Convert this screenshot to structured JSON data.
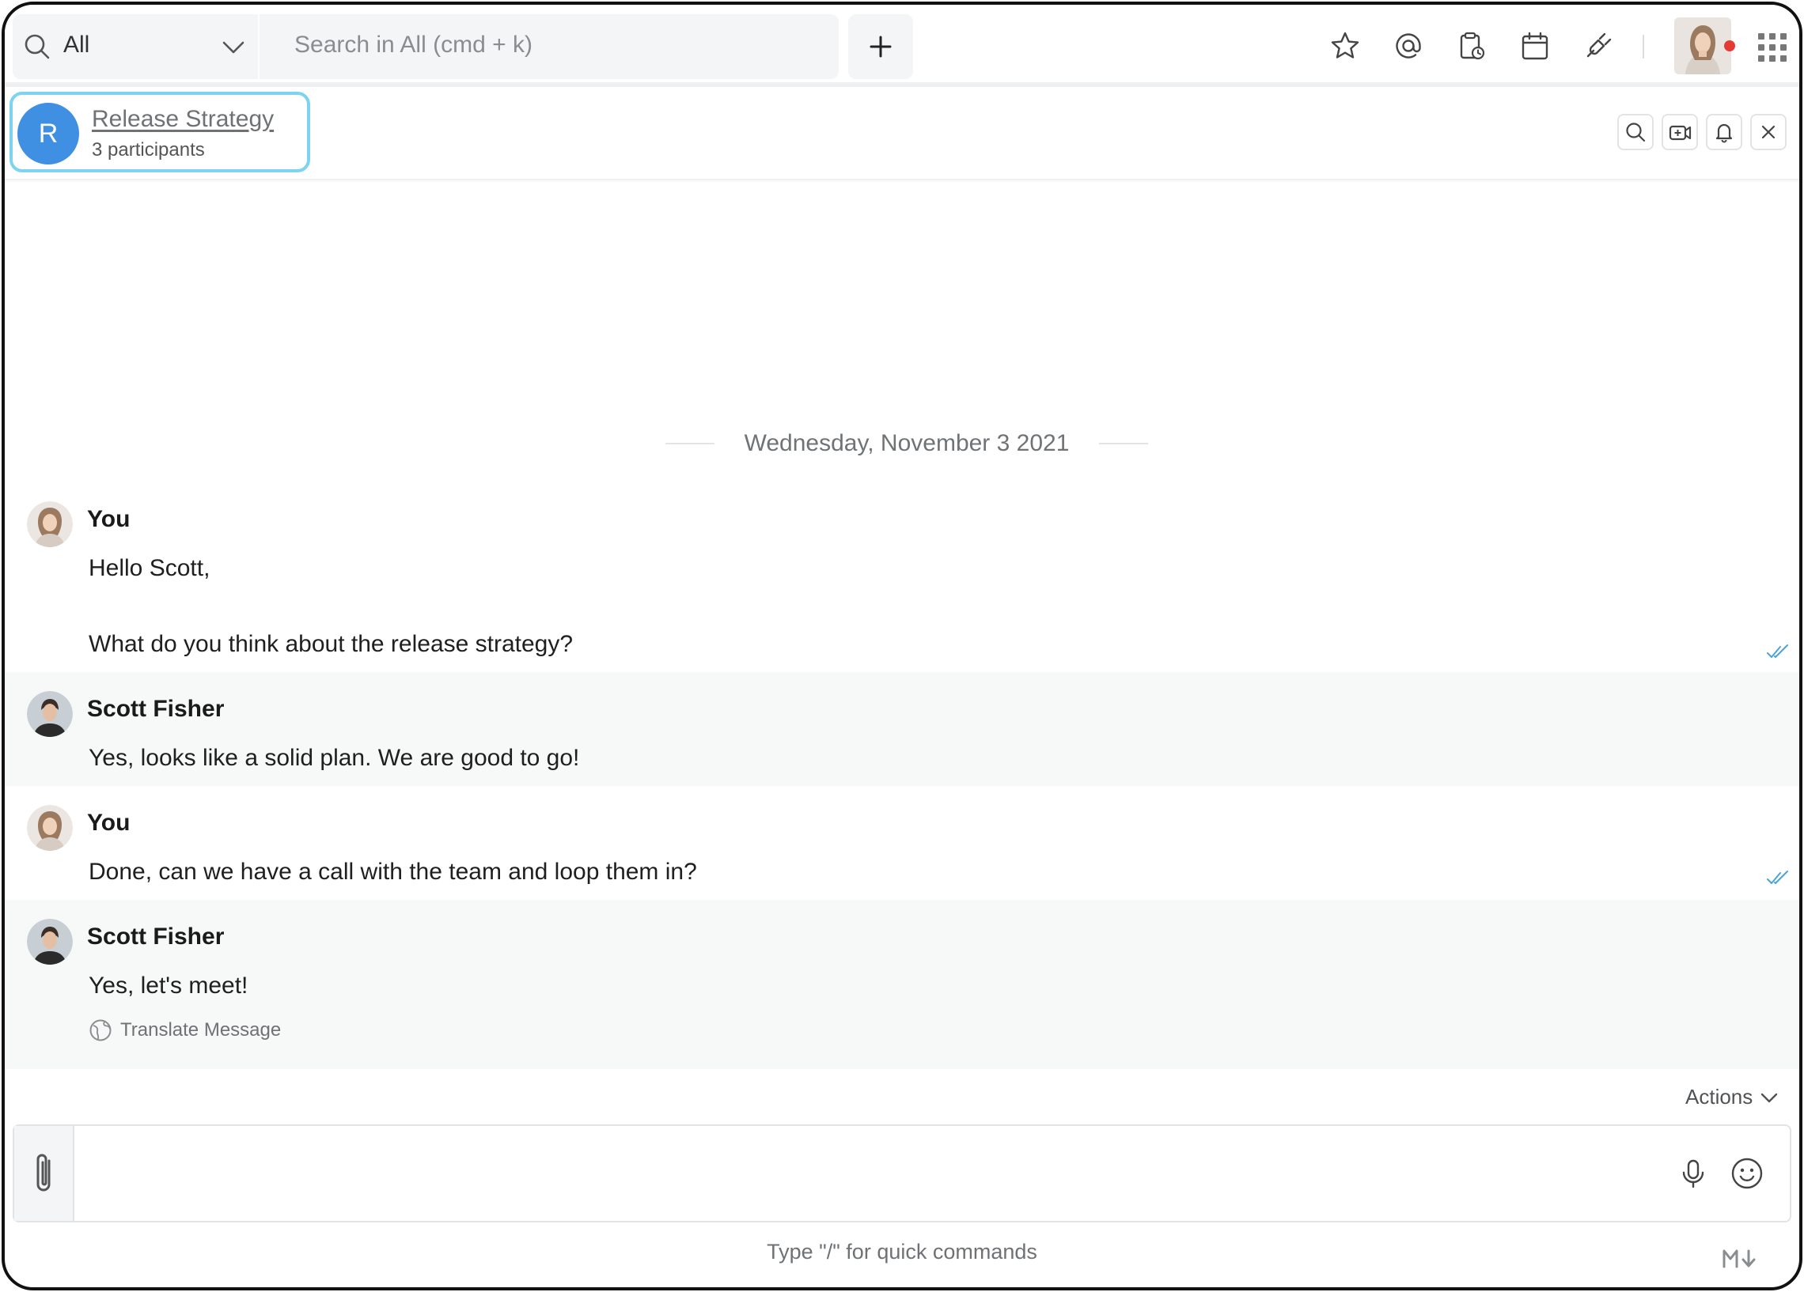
{
  "topbar": {
    "scope_label": "All",
    "search_placeholder": "Search in All (cmd + k)"
  },
  "channel": {
    "avatar_letter": "R",
    "name": "Release Strategy",
    "participants": "3 participants"
  },
  "date_separator": "Wednesday, November 3 2021",
  "messages": [
    {
      "author": "You",
      "lines": [
        "Hello Scott,",
        "What do you think about the release strategy?"
      ],
      "read": true
    },
    {
      "author": "Scott Fisher",
      "lines": [
        "Yes, looks like a solid plan. We are good to go!"
      ],
      "read": false
    },
    {
      "author": "You",
      "lines": [
        "Done, can we have a call with the team and loop them in?"
      ],
      "read": true
    },
    {
      "author": "Scott Fisher",
      "lines": [
        "Yes, let's meet!"
      ],
      "read": false
    }
  ],
  "translate_label": "Translate Message",
  "composer": {
    "actions_label": "Actions",
    "hint": "Type \"/\" for quick commands"
  },
  "colors": {
    "accent": "#3f8fe3",
    "focus_ring": "#7dd3f0",
    "read_receipt": "#4aa3df",
    "status_dot": "#e53935"
  }
}
